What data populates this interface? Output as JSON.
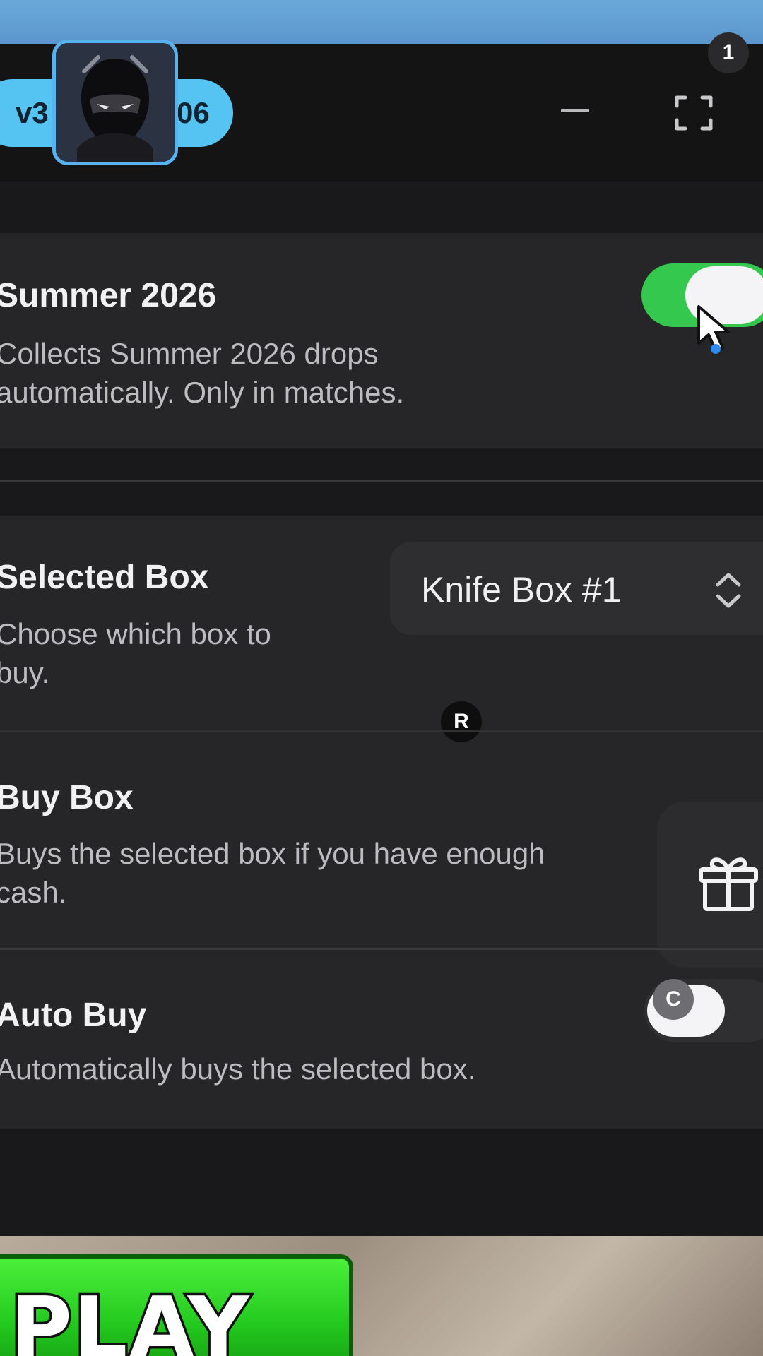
{
  "header": {
    "version_left": "v3",
    "version_right": "06",
    "notification_count": "1"
  },
  "auto_collect": {
    "title": "Summer 2026",
    "description_line1": "Collects Summer 2026 drops",
    "description_line2": "automatically. Only in matches.",
    "enabled": true
  },
  "selected_box": {
    "title": "Selected Box",
    "description_line1": "Choose which box to",
    "description_line2": "buy.",
    "value": "Knife Box #1"
  },
  "buy_box": {
    "title": "Buy Box",
    "description_line1": "Buys the selected box if you have enough",
    "description_line2": "cash."
  },
  "auto_buy": {
    "title": "Auto Buy",
    "description": "Automatically buys the selected box.",
    "enabled": false
  },
  "shortcuts": {
    "r": "R",
    "c": "C"
  },
  "game": {
    "play_label": "PLAY"
  },
  "colors": {
    "accent_blue": "#56c4f2",
    "toggle_on": "#34c94e",
    "panel": "#262628",
    "play_green": "#23c81e"
  }
}
